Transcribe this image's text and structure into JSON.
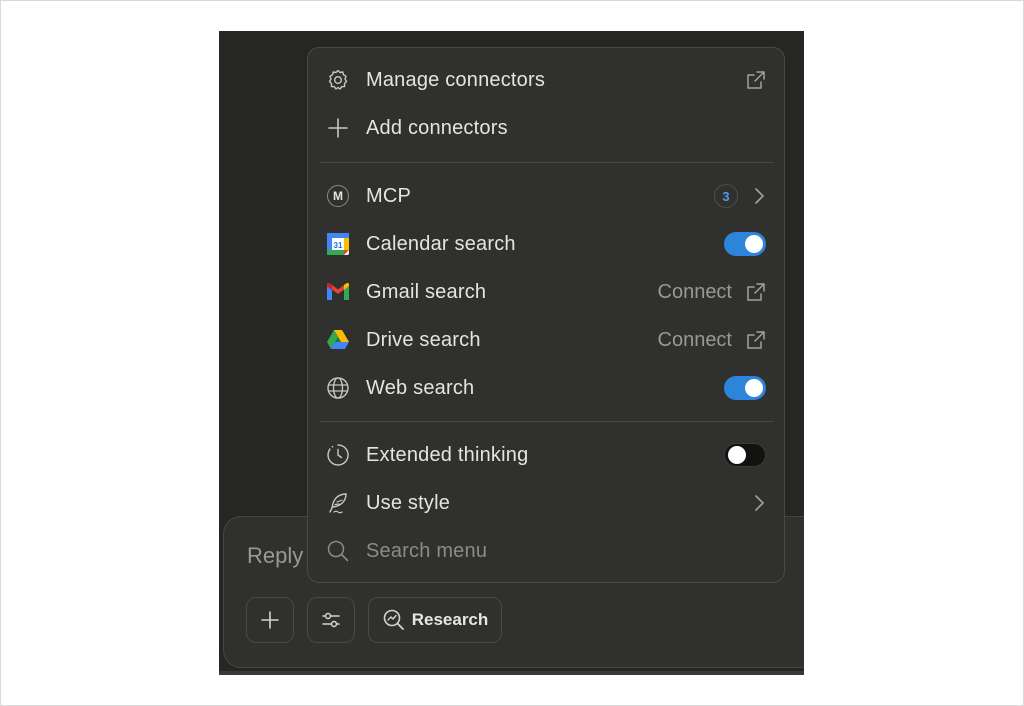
{
  "composer": {
    "placeholder": "Reply",
    "research_label": "Research"
  },
  "menu": {
    "manage_connectors": "Manage connectors",
    "add_connectors": "Add connectors",
    "mcp": {
      "label": "MCP",
      "badge": "3",
      "icon_letter": "M"
    },
    "calendar": {
      "label": "Calendar search",
      "icon_text": "31",
      "enabled": true
    },
    "gmail": {
      "label": "Gmail search",
      "action": "Connect"
    },
    "drive": {
      "label": "Drive search",
      "action": "Connect"
    },
    "web": {
      "label": "Web search",
      "enabled": true
    },
    "extended_thinking": {
      "label": "Extended thinking",
      "enabled": false
    },
    "use_style": "Use style",
    "search_placeholder": "Search menu"
  },
  "colors": {
    "toggle_on": "#2c84db",
    "badge_text": "#4a9ce8",
    "background": "#262624",
    "menu_background": "#30302e"
  }
}
